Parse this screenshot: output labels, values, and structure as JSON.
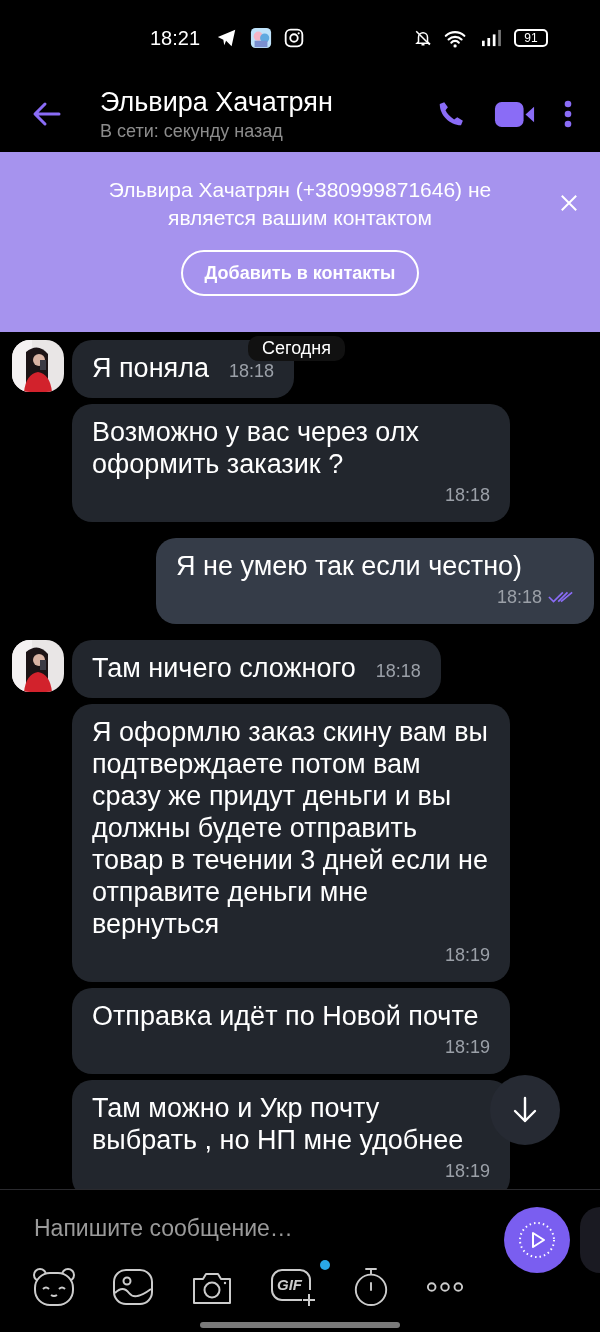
{
  "status_bar": {
    "time": "18:21",
    "battery": "91"
  },
  "header": {
    "name": "Эльвира Хачатрян",
    "presence": "В сети: секунду назад"
  },
  "banner": {
    "text": "Эльвира Хачатрян (+380999871646) не является вашим контактом",
    "button": "Добавить в контакты"
  },
  "date_label": "Сегодня",
  "messages": [
    {
      "kind": "incoming",
      "text": "Я поняла",
      "time": "18:18"
    },
    {
      "kind": "incoming",
      "text": "Возможно у вас через олх оформить заказик ?",
      "time": "18:18"
    },
    {
      "kind": "outgoing",
      "text": "Я не умею так если честно)",
      "time": "18:18",
      "read": true
    },
    {
      "kind": "incoming",
      "text": "Там ничего сложного",
      "time": "18:18"
    },
    {
      "kind": "incoming",
      "text": "Я оформлю заказ скину вам вы подтверждаете потом вам сразу же придут деньги и вы должны будете отправить товар в течении 3 дней если не отправите деньги мне вернуться",
      "time": "18:19"
    },
    {
      "kind": "incoming",
      "text": "Отправка идёт по Новой почте",
      "time": "18:19"
    },
    {
      "kind": "incoming",
      "text": "Там можно и Укр почту выбрать , но НП мне удобнее",
      "time": "18:19"
    }
  ],
  "composer": {
    "placeholder": "Напишите сообщение…",
    "gif_label": "GIF",
    "gif_new": true
  }
}
